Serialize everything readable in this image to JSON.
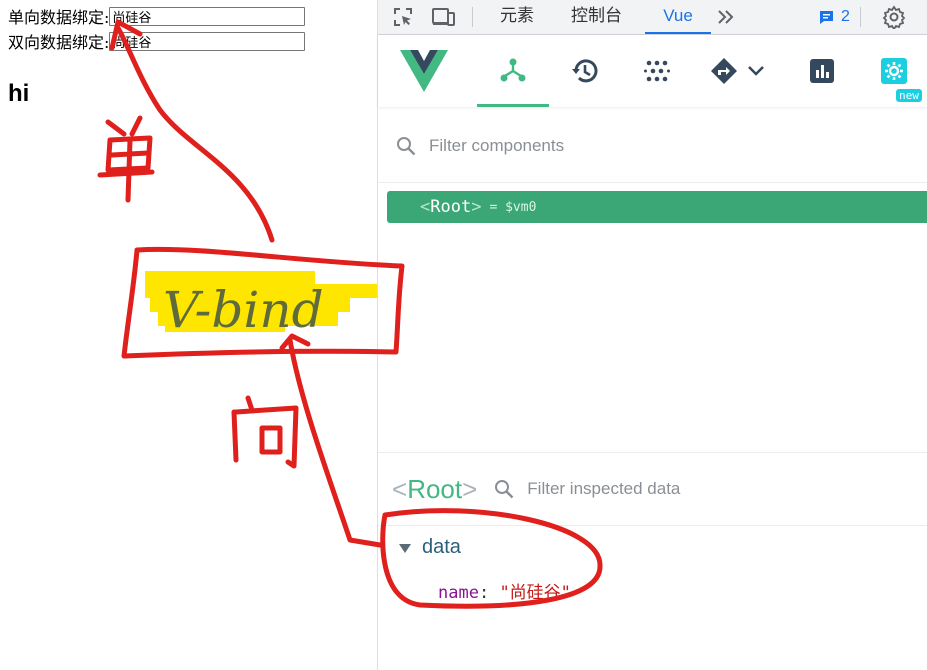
{
  "page": {
    "row1_label": "单向数据绑定:",
    "row1_value": "尚硅谷",
    "row2_label": "双向数据绑定:",
    "row2_value": "尚硅谷",
    "heading": "hi"
  },
  "devtools": {
    "tabs": [
      "元素",
      "控制台",
      "Vue"
    ],
    "active_tab": "Vue",
    "issues_count": "2",
    "vue_new_badge": "new",
    "filter_components_placeholder": "Filter components",
    "root_tag": "Root",
    "root_alias": "= $vm0",
    "inspect_root": "Root",
    "filter_inspected_placeholder": "Filter inspected data",
    "data_section": "data",
    "data_key": "name",
    "data_value": "\"尚硅谷\""
  },
  "annotations": {
    "highlight_text": "V-bind",
    "note_top": "单",
    "note_bottom": "向"
  },
  "colors": {
    "vue_green": "#42b883",
    "root_row_bg": "#3ba776",
    "devtools_blue": "#1a73e8",
    "annotation_red": "#e0201c",
    "highlight_yellow": "#ffe600"
  }
}
